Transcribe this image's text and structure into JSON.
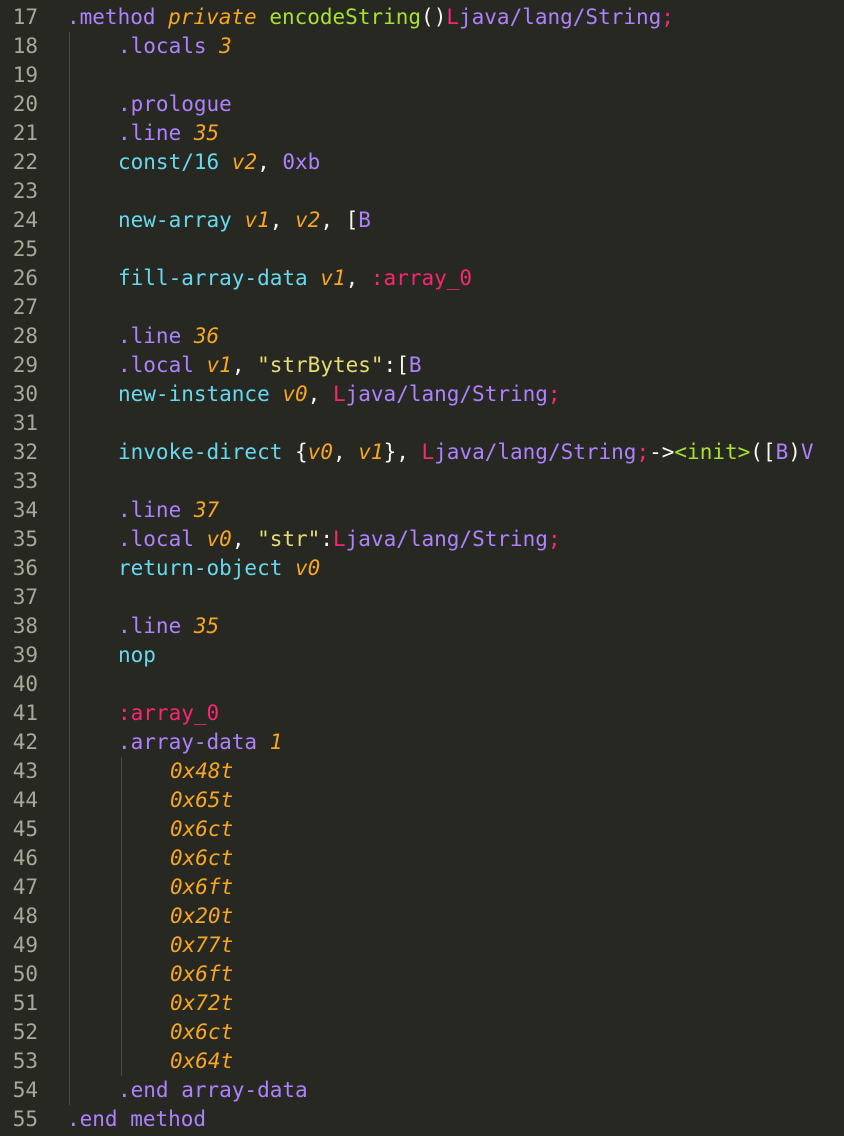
{
  "editor": {
    "lines": [
      {
        "n": "17",
        "indent": 0,
        "tokens": [
          {
            "t": ".method ",
            "c": "dir"
          },
          {
            "t": "private",
            "c": "kw"
          },
          {
            "t": " ",
            "c": "plain"
          },
          {
            "t": "encodeString",
            "c": "fn"
          },
          {
            "t": "()",
            "c": "plain"
          },
          {
            "t": "L",
            "c": "type"
          },
          {
            "t": "java/lang/String",
            "c": "dir"
          },
          {
            "t": ";",
            "c": "type"
          }
        ]
      },
      {
        "n": "18",
        "indent": 1,
        "tokens": [
          {
            "t": ".locals ",
            "c": "dir"
          },
          {
            "t": "3",
            "c": "num"
          }
        ]
      },
      {
        "n": "19",
        "indent": 1,
        "tokens": []
      },
      {
        "n": "20",
        "indent": 1,
        "tokens": [
          {
            "t": ".prologue",
            "c": "dir"
          }
        ]
      },
      {
        "n": "21",
        "indent": 1,
        "tokens": [
          {
            "t": ".line ",
            "c": "dir"
          },
          {
            "t": "35",
            "c": "num"
          }
        ]
      },
      {
        "n": "22",
        "indent": 1,
        "tokens": [
          {
            "t": "const/16 ",
            "c": "op"
          },
          {
            "t": "v2",
            "c": "reg"
          },
          {
            "t": ", ",
            "c": "plain"
          },
          {
            "t": "0xb",
            "c": "hex"
          }
        ]
      },
      {
        "n": "23",
        "indent": 1,
        "tokens": []
      },
      {
        "n": "24",
        "indent": 1,
        "tokens": [
          {
            "t": "new-array ",
            "c": "op"
          },
          {
            "t": "v1",
            "c": "reg"
          },
          {
            "t": ", ",
            "c": "plain"
          },
          {
            "t": "v2",
            "c": "reg"
          },
          {
            "t": ", [",
            "c": "plain"
          },
          {
            "t": "B",
            "c": "dir"
          }
        ]
      },
      {
        "n": "25",
        "indent": 1,
        "tokens": []
      },
      {
        "n": "26",
        "indent": 1,
        "tokens": [
          {
            "t": "fill-array-data ",
            "c": "op"
          },
          {
            "t": "v1",
            "c": "reg"
          },
          {
            "t": ", ",
            "c": "plain"
          },
          {
            "t": ":array_0",
            "c": "lbl"
          }
        ]
      },
      {
        "n": "27",
        "indent": 1,
        "tokens": []
      },
      {
        "n": "28",
        "indent": 1,
        "tokens": [
          {
            "t": ".line ",
            "c": "dir"
          },
          {
            "t": "36",
            "c": "num"
          }
        ]
      },
      {
        "n": "29",
        "indent": 1,
        "tokens": [
          {
            "t": ".local ",
            "c": "dir"
          },
          {
            "t": "v1",
            "c": "reg"
          },
          {
            "t": ", ",
            "c": "plain"
          },
          {
            "t": "\"strBytes\"",
            "c": "str"
          },
          {
            "t": ":[",
            "c": "plain"
          },
          {
            "t": "B",
            "c": "dir"
          }
        ]
      },
      {
        "n": "30",
        "indent": 1,
        "tokens": [
          {
            "t": "new-instance ",
            "c": "op"
          },
          {
            "t": "v0",
            "c": "reg"
          },
          {
            "t": ", ",
            "c": "plain"
          },
          {
            "t": "L",
            "c": "type"
          },
          {
            "t": "java/lang/String",
            "c": "dir"
          },
          {
            "t": ";",
            "c": "type"
          }
        ]
      },
      {
        "n": "31",
        "indent": 1,
        "tokens": []
      },
      {
        "n": "32",
        "indent": 1,
        "tokens": [
          {
            "t": "invoke-direct ",
            "c": "op"
          },
          {
            "t": "{",
            "c": "plain"
          },
          {
            "t": "v0",
            "c": "reg"
          },
          {
            "t": ", ",
            "c": "plain"
          },
          {
            "t": "v1",
            "c": "reg"
          },
          {
            "t": "}, ",
            "c": "plain"
          },
          {
            "t": "L",
            "c": "type"
          },
          {
            "t": "java/lang/String",
            "c": "dir"
          },
          {
            "t": ";",
            "c": "type"
          },
          {
            "t": "->",
            "c": "plain"
          },
          {
            "t": "<init>",
            "c": "fn"
          },
          {
            "t": "([",
            "c": "plain"
          },
          {
            "t": "B",
            "c": "dir"
          },
          {
            "t": ")",
            "c": "plain"
          },
          {
            "t": "V",
            "c": "dir"
          }
        ]
      },
      {
        "n": "33",
        "indent": 1,
        "tokens": []
      },
      {
        "n": "34",
        "indent": 1,
        "tokens": [
          {
            "t": ".line ",
            "c": "dir"
          },
          {
            "t": "37",
            "c": "num"
          }
        ]
      },
      {
        "n": "35",
        "indent": 1,
        "tokens": [
          {
            "t": ".local ",
            "c": "dir"
          },
          {
            "t": "v0",
            "c": "reg"
          },
          {
            "t": ", ",
            "c": "plain"
          },
          {
            "t": "\"str\"",
            "c": "str"
          },
          {
            "t": ":",
            "c": "plain"
          },
          {
            "t": "L",
            "c": "type"
          },
          {
            "t": "java/lang/String",
            "c": "dir"
          },
          {
            "t": ";",
            "c": "type"
          }
        ]
      },
      {
        "n": "36",
        "indent": 1,
        "tokens": [
          {
            "t": "return-object ",
            "c": "op"
          },
          {
            "t": "v0",
            "c": "reg"
          }
        ]
      },
      {
        "n": "37",
        "indent": 1,
        "tokens": []
      },
      {
        "n": "38",
        "indent": 1,
        "tokens": [
          {
            "t": ".line ",
            "c": "dir"
          },
          {
            "t": "35",
            "c": "num"
          }
        ]
      },
      {
        "n": "39",
        "indent": 1,
        "tokens": [
          {
            "t": "nop",
            "c": "op"
          }
        ]
      },
      {
        "n": "40",
        "indent": 1,
        "tokens": []
      },
      {
        "n": "41",
        "indent": 1,
        "tokens": [
          {
            "t": ":array_0",
            "c": "lbl"
          }
        ]
      },
      {
        "n": "42",
        "indent": 1,
        "tokens": [
          {
            "t": ".array-data ",
            "c": "dir"
          },
          {
            "t": "1",
            "c": "num"
          }
        ]
      },
      {
        "n": "43",
        "indent": 2,
        "tokens": [
          {
            "t": "0x48t",
            "c": "hexdata"
          }
        ]
      },
      {
        "n": "44",
        "indent": 2,
        "tokens": [
          {
            "t": "0x65t",
            "c": "hexdata"
          }
        ]
      },
      {
        "n": "45",
        "indent": 2,
        "tokens": [
          {
            "t": "0x6ct",
            "c": "hexdata"
          }
        ]
      },
      {
        "n": "46",
        "indent": 2,
        "tokens": [
          {
            "t": "0x6ct",
            "c": "hexdata"
          }
        ]
      },
      {
        "n": "47",
        "indent": 2,
        "tokens": [
          {
            "t": "0x6ft",
            "c": "hexdata"
          }
        ]
      },
      {
        "n": "48",
        "indent": 2,
        "tokens": [
          {
            "t": "0x20t",
            "c": "hexdata"
          }
        ]
      },
      {
        "n": "49",
        "indent": 2,
        "tokens": [
          {
            "t": "0x77t",
            "c": "hexdata"
          }
        ]
      },
      {
        "n": "50",
        "indent": 2,
        "tokens": [
          {
            "t": "0x6ft",
            "c": "hexdata"
          }
        ]
      },
      {
        "n": "51",
        "indent": 2,
        "tokens": [
          {
            "t": "0x72t",
            "c": "hexdata"
          }
        ]
      },
      {
        "n": "52",
        "indent": 2,
        "tokens": [
          {
            "t": "0x6ct",
            "c": "hexdata"
          }
        ]
      },
      {
        "n": "53",
        "indent": 2,
        "tokens": [
          {
            "t": "0x64t",
            "c": "hexdata"
          }
        ]
      },
      {
        "n": "54",
        "indent": 1,
        "tokens": [
          {
            "t": ".end array-data",
            "c": "dir"
          }
        ]
      },
      {
        "n": "55",
        "indent": 0,
        "tokens": [
          {
            "t": ".end method",
            "c": "dir"
          }
        ]
      }
    ]
  },
  "theme": {
    "background": "#272822",
    "gutter_text": "#a8a89a",
    "directive": "#ae81ff",
    "keyword": "#f6a623",
    "function": "#a6e22e",
    "type_marker": "#f92672",
    "opcode": "#66d9ef",
    "string": "#e6db74",
    "plain": "#f8f8f2"
  }
}
